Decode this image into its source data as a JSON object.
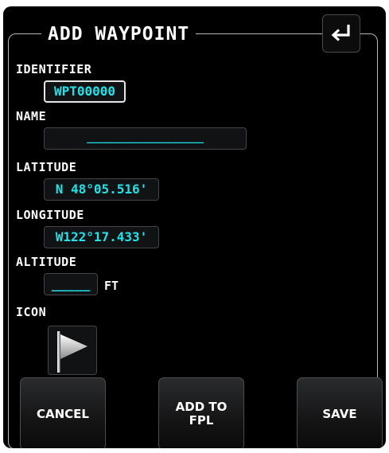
{
  "title": "ADD WAYPOINT",
  "icons": {
    "enter": "enter-return-icon",
    "waypoint_icon": "flag-icon"
  },
  "colors": {
    "field_text": "#1fe3ea",
    "background": "#000000",
    "label": "#ffffff"
  },
  "fields": {
    "identifier": {
      "label": "IDENTIFIER",
      "value": "WPT00000"
    },
    "name": {
      "label": "NAME",
      "value": "____________________"
    },
    "latitude": {
      "label": "LATITUDE",
      "value": "N 48°05.516'"
    },
    "longitude": {
      "label": "LONGITUDE",
      "value": "W122°17.433'"
    },
    "altitude": {
      "label": "ALTITUDE",
      "value": "_____",
      "unit": "FT"
    },
    "icon": {
      "label": "ICON"
    }
  },
  "buttons": {
    "cancel": "CANCEL",
    "add_to_fpl": "ADD TO\nFPL",
    "save": "SAVE"
  }
}
